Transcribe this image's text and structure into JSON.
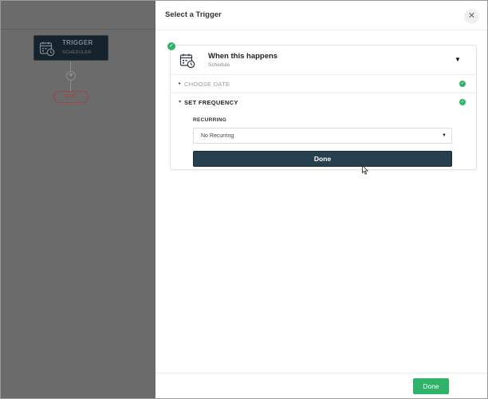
{
  "canvas": {
    "trigger_node": {
      "title": "TRIGGER",
      "subtitle": "SCHEDULER",
      "icon": "calendar-clock-icon"
    },
    "add_symbol": "+",
    "end_label": "END"
  },
  "panel": {
    "title": "Select a Trigger",
    "close_symbol": "✕",
    "card": {
      "title": "When this happens",
      "subtitle": "Schedule",
      "icon": "calendar-clock-icon",
      "caret": "▼",
      "sections": {
        "choose_date": {
          "label": "CHOOSE DATE",
          "caret": "▸"
        },
        "set_frequency": {
          "label": "SET FREQUENCY",
          "caret": "▾"
        }
      },
      "recurring": {
        "label": "RECURRING",
        "value": "No Recurring",
        "caret": "▼"
      },
      "done_label": "Done"
    },
    "footer_done_label": "Done"
  },
  "colors": {
    "accent_green": "#2fb36a",
    "done_dark": "#27404f",
    "end_red": "#a34343",
    "canvas_gray": "#6b6b6b"
  }
}
